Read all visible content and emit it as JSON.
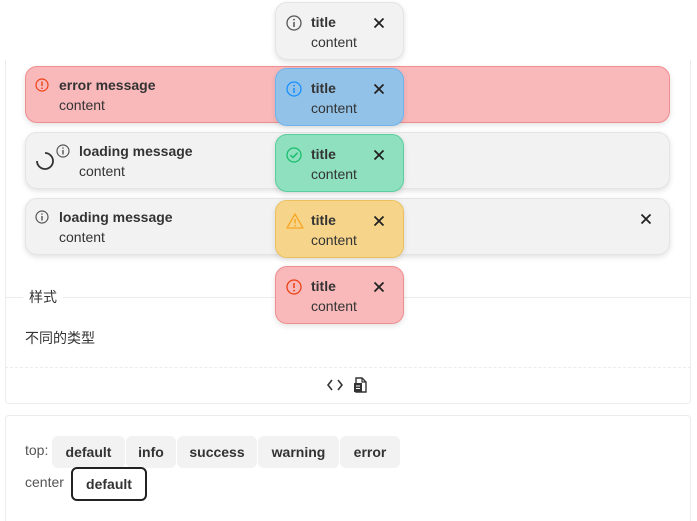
{
  "section": {
    "title": "样式",
    "description": "不同的类型"
  },
  "notices": [
    {
      "type": "error",
      "title": "error message",
      "content": "content"
    },
    {
      "type": "loading",
      "title": "loading message",
      "content": "content"
    },
    {
      "type": "info",
      "title": "loading message",
      "content": "content"
    }
  ],
  "toasts": [
    {
      "type": "gray",
      "title": "title",
      "content": "content"
    },
    {
      "type": "info",
      "title": "title",
      "content": "content"
    },
    {
      "type": "success",
      "title": "title",
      "content": "content"
    },
    {
      "type": "warning",
      "title": "title",
      "content": "content"
    },
    {
      "type": "error",
      "title": "title",
      "content": "content"
    }
  ],
  "controls": {
    "top_label": "top:",
    "top_buttons": [
      "default",
      "info",
      "success",
      "warning",
      "error"
    ],
    "center_label": "center",
    "center_buttons": [
      "default"
    ]
  },
  "colors": {
    "info": "#1890ff",
    "success": "#19be6b",
    "warning": "#f5a623",
    "error": "#ed4014",
    "neutral": "#555555"
  },
  "icons": {
    "code": "code-icon",
    "copy": "copy-icon",
    "close": "close-icon",
    "info": "info-icon",
    "success": "check-circle-icon",
    "warning": "warning-icon",
    "error": "error-icon",
    "loading": "loading-spinner-icon"
  }
}
